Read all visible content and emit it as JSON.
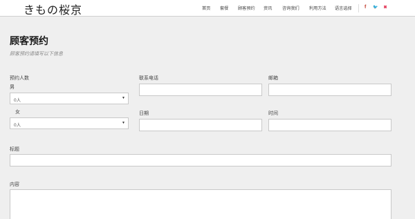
{
  "header": {
    "logo": "きもの桜京",
    "nav": [
      "首页",
      "套餐",
      "顾客预约",
      "资讯",
      "咨询我们",
      "利用方法",
      "语言选择"
    ],
    "social": [
      {
        "icon": "facebook-icon",
        "glyph": "f",
        "color": "#c0392b"
      },
      {
        "icon": "twitter-icon",
        "glyph": "🐦",
        "color": "#1da1f2"
      },
      {
        "icon": "instagram-icon",
        "glyph": "◙",
        "color": "#e4405f"
      }
    ]
  },
  "form": {
    "title": "顾客预约",
    "subtitle": "顾客预约请填写以下信息",
    "people_label": "预约人数",
    "male_label": "男",
    "male_value": "0人",
    "female_label": "女",
    "female_value": "0人",
    "phone_label": "联系电话",
    "email_label": "邮箱",
    "date_label": "日期",
    "time_label": "时间",
    "subject_label": "标题",
    "content_label": "内容"
  }
}
